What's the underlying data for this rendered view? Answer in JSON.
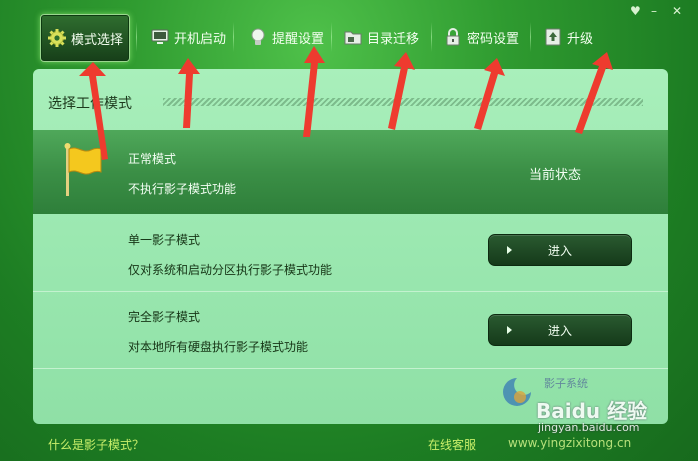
{
  "window_controls": {
    "pin": "♥",
    "minimize": "–",
    "close": "✕"
  },
  "toolbar": {
    "mode": "模式选择",
    "boot": "开机启动",
    "remind": "提醒设置",
    "migrate": "目录迁移",
    "password": "密码设置",
    "upgrade": "升级"
  },
  "panel": {
    "title": "选择工作模式",
    "modes": [
      {
        "name": "正常模式",
        "desc": "不执行影子模式功能",
        "status": "当前状态"
      },
      {
        "name": "单一影子模式",
        "desc": "仅对系统和启动分区执行影子模式功能",
        "button": "进入"
      },
      {
        "name": "完全影子模式",
        "desc": "对本地所有硬盘执行影子模式功能",
        "button": "进入"
      }
    ]
  },
  "footer": {
    "help_link": "什么是影子模式？",
    "support_link": "在线客服",
    "site_link": "www.yingzixitong.cn"
  },
  "watermark": {
    "product_text": "影子系统",
    "brand": "Baidu 经验",
    "url": "jingyan.baidu.com"
  },
  "colors": {
    "accent": "#2f9b30",
    "panel": "#9de9b2",
    "arrow": "#ee3b2f",
    "link": "#c9ef6a"
  }
}
